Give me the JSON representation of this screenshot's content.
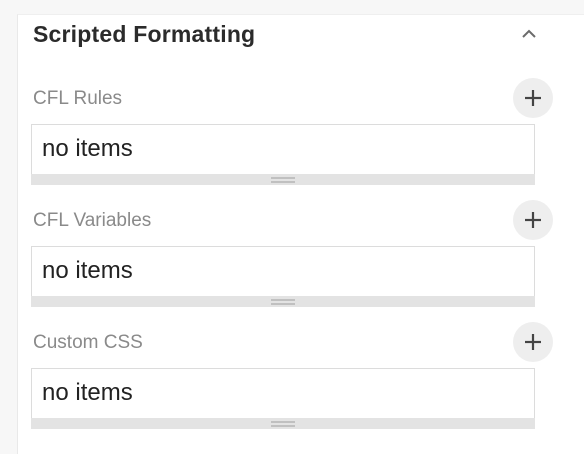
{
  "panel": {
    "title": "Scripted Formatting",
    "collapse_icon": "chevron-up-icon"
  },
  "sections": [
    {
      "label": "CFL Rules",
      "empty_text": "no items",
      "add_icon": "plus-icon"
    },
    {
      "label": "CFL Variables",
      "empty_text": "no items",
      "add_icon": "plus-icon"
    },
    {
      "label": "Custom CSS",
      "empty_text": "no items",
      "add_icon": "plus-icon"
    }
  ],
  "colors": {
    "title": "#2b2b2b",
    "label": "#8a8a8a",
    "border": "#dcdcdc",
    "handle": "#e3e3e3",
    "add_button_bg": "#eeeeee"
  }
}
